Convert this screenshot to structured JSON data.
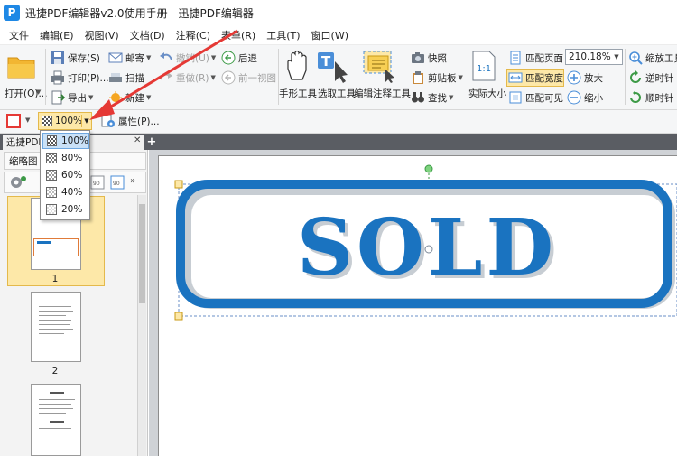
{
  "window": {
    "title": "迅捷PDF编辑器v2.0使用手册 - 迅捷PDF编辑器",
    "logo_letter": "P"
  },
  "menu": [
    "文件",
    "编辑(E)",
    "视图(V)",
    "文档(D)",
    "注释(C)",
    "表单(R)",
    "工具(T)",
    "窗口(W)"
  ],
  "ribbon": {
    "open": "打开(O)...",
    "save": "保存(S)",
    "print": "打印(P)...",
    "export": "导出",
    "mail": "邮寄",
    "scan": "扫描",
    "new": "新建",
    "undo": "撤销(U)",
    "redo": "重做(R)",
    "back": "后退",
    "prev_view": "前一视图",
    "hand_tool": "手形工具",
    "select_tool": "选取工具",
    "annot_tool": "编辑注释工具",
    "snapshot": "快照",
    "clipboard": "剪贴板",
    "find": "查找",
    "actual_size": "实际大小",
    "fit_page": "匹配页面",
    "fit_width": "匹配宽度",
    "fit_visible": "匹配可见",
    "zoom_value": "210.18%",
    "zoom_in": "放大",
    "zoom_out": "缩小",
    "zoom_tool": "缩放工具",
    "rotate_ccw": "逆时针",
    "rotate_cw": "顺时针"
  },
  "format_bar": {
    "opacity": "100%",
    "properties": "属性(P)..."
  },
  "tab": {
    "label": "迅捷PDF使用手册 *"
  },
  "panel": {
    "title": "缩略图",
    "pages": [
      "1",
      "2"
    ]
  },
  "opacity_menu": {
    "options": [
      "100%",
      "80%",
      "60%",
      "40%",
      "20%"
    ],
    "selected": "100%",
    "gray_levels": [
      "#555555",
      "#777777",
      "#999999",
      "#bbbbbb",
      "#dddddd"
    ]
  },
  "stamp": {
    "text": "SOLD",
    "color": "#1a73c0",
    "shadow_color": "#c7cdd3"
  },
  "colors": {
    "accent": "#1a73c0",
    "highlight": "#fde8a8",
    "arrow": "#e53935"
  }
}
